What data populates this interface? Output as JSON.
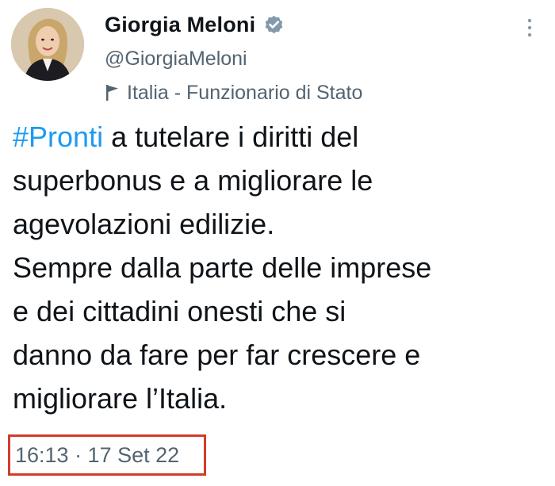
{
  "author": {
    "display_name": "Giorgia Meloni",
    "handle": "@GiorgiaMeloni",
    "affiliation": "Italia - Funzionario di Stato",
    "verified_icon": "verified-badge-icon",
    "affiliation_icon": "flag-icon"
  },
  "tweet": {
    "hashtag": "#Pronti",
    "line1_rest": " a tutelare i diritti del",
    "line2": "superbonus e a migliorare le",
    "line3": "agevolazioni edilizie.",
    "line4": "Sempre dalla parte delle imprese",
    "line5": "e dei cittadini onesti che si",
    "line6": "danno da fare per far crescere e",
    "line7": "migliorare l’Italia.",
    "timestamp": "16:13 · 17 Set 22"
  },
  "colors": {
    "hashtag": "#1d9bf0",
    "secondary_text": "#536471",
    "highlight_box": "#d33b2c",
    "verified_badge": "#829aab"
  },
  "menu_icon": "more-vertical-icon"
}
